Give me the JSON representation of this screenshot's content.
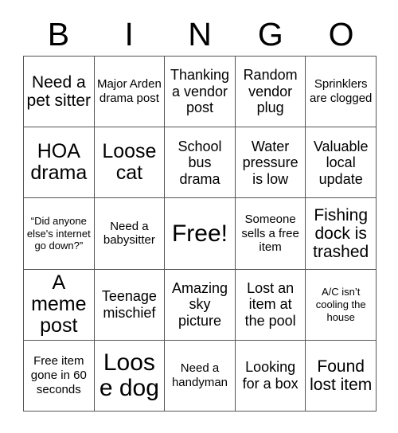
{
  "card": {
    "title": "BINGO",
    "header_letters": [
      "B",
      "I",
      "N",
      "G",
      "O"
    ],
    "free_space_index": 12,
    "colors": {
      "background": "#ffffff",
      "text": "#000000",
      "grid_line": "#555555"
    },
    "rows": [
      [
        {
          "text": "Need a pet sitter",
          "size": "lg"
        },
        {
          "text": "Major Arden drama post",
          "size": "sm"
        },
        {
          "text": "Thanking a vendor post",
          "size": "md"
        },
        {
          "text": "Random vendor plug",
          "size": "md"
        },
        {
          "text": "Sprinklers are clogged",
          "size": "sm"
        }
      ],
      [
        {
          "text": "HOA drama",
          "size": "xl"
        },
        {
          "text": "Loose cat",
          "size": "xl"
        },
        {
          "text": "School bus drama",
          "size": "md"
        },
        {
          "text": "Water pressure is low",
          "size": "md"
        },
        {
          "text": "Valuable local update",
          "size": "md"
        }
      ],
      [
        {
          "text": "“Did anyone else's internet go down?”",
          "size": "xs"
        },
        {
          "text": "Need a babysitter",
          "size": "sm"
        },
        {
          "text": "Free!",
          "size": "xxl"
        },
        {
          "text": "Someone sells a free item",
          "size": "sm"
        },
        {
          "text": "Fishing dock is trashed",
          "size": "lg"
        }
      ],
      [
        {
          "text": "A meme post",
          "size": "xl"
        },
        {
          "text": "Teenage mischief",
          "size": "md"
        },
        {
          "text": "Amazing sky picture",
          "size": "md"
        },
        {
          "text": "Lost an item at the pool",
          "size": "md"
        },
        {
          "text": "A/C isn’t cooling the house",
          "size": "xs"
        }
      ],
      [
        {
          "text": "Free item gone in 60 seconds",
          "size": "sm"
        },
        {
          "text": "Loose dog",
          "size": "xxl"
        },
        {
          "text": "Need a handyman",
          "size": "sm"
        },
        {
          "text": "Looking for a box",
          "size": "md"
        },
        {
          "text": "Found lost item",
          "size": "lg"
        }
      ]
    ]
  }
}
